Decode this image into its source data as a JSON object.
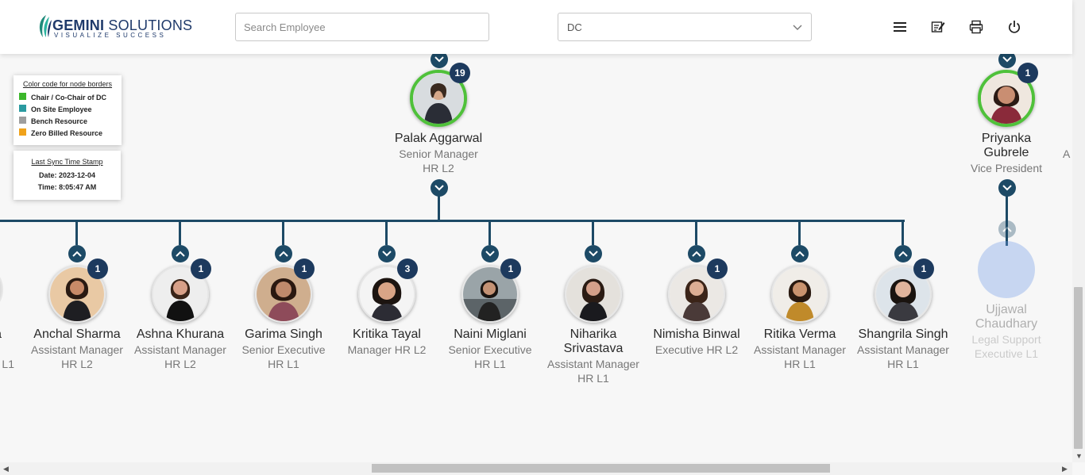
{
  "header": {
    "logo": {
      "name_bold": "GEMINI",
      "name_rest": " SOLUTIONS",
      "tagline": "VISUALIZE SUCCESS"
    },
    "search_placeholder": "Search Employee",
    "select_value": "DC",
    "icons": [
      "menu-icon",
      "edit-note-icon",
      "print-icon",
      "power-icon"
    ]
  },
  "legend": {
    "title": "Color code for node borders",
    "items": [
      {
        "label": "Chair / Co-Chair of DC",
        "color": "#3cb72b"
      },
      {
        "label": "On Site Employee",
        "color": "#2a9aa0"
      },
      {
        "label": "Bench Resource",
        "color": "#9e9e9e"
      },
      {
        "label": "Zero Billed Resource",
        "color": "#f0a21a"
      }
    ]
  },
  "sync": {
    "title": "Last Sync Time Stamp",
    "date": "Date: 2023-12-04",
    "time": "Time: 8:05:47 AM"
  },
  "top_nodes": [
    {
      "name": "Palak Aggarwal",
      "designation": "Senior Manager",
      "level": "HR L2",
      "count": "19"
    },
    {
      "name_line1": "Priyanka",
      "name_line2": "Gubrele",
      "designation": "Vice President",
      "count": "1"
    }
  ],
  "cut_text": {
    "left_name": "a",
    "left_level": "L1",
    "right_a": "A"
  },
  "children": [
    {
      "name": "Anchal Sharma",
      "designation": "Assistant Manager",
      "level": "HR L2",
      "count": "1"
    },
    {
      "name": "Ashna Khurana",
      "designation": "Assistant Manager",
      "level": "HR L2",
      "count": "1"
    },
    {
      "name": "Garima Singh",
      "designation": "Senior Executive",
      "level": "HR L1",
      "count": "1"
    },
    {
      "name": "Kritika Tayal",
      "designation": "Manager HR L2",
      "level": "",
      "count": "3"
    },
    {
      "name": "Naini Miglani",
      "designation": "Senior Executive",
      "level": "HR L1",
      "count": "1"
    },
    {
      "name_line1": "Niharika",
      "name_line2": "Srivastava",
      "designation": "Assistant Manager",
      "level": "HR L1",
      "count": ""
    },
    {
      "name": "Nimisha Binwal",
      "designation": "Executive HR L2",
      "level": "",
      "count": "1"
    },
    {
      "name": "Ritika Verma",
      "designation": "Assistant Manager",
      "level": "HR L1",
      "count": ""
    },
    {
      "name": "Shangrila Singh",
      "designation": "Assistant Manager",
      "level": "HR L1",
      "count": "1"
    }
  ],
  "faded_child": {
    "name_line1": "Ujjawal",
    "name_line2": "Chaudhary",
    "designation": "Legal Support",
    "level": "Executive L1"
  }
}
